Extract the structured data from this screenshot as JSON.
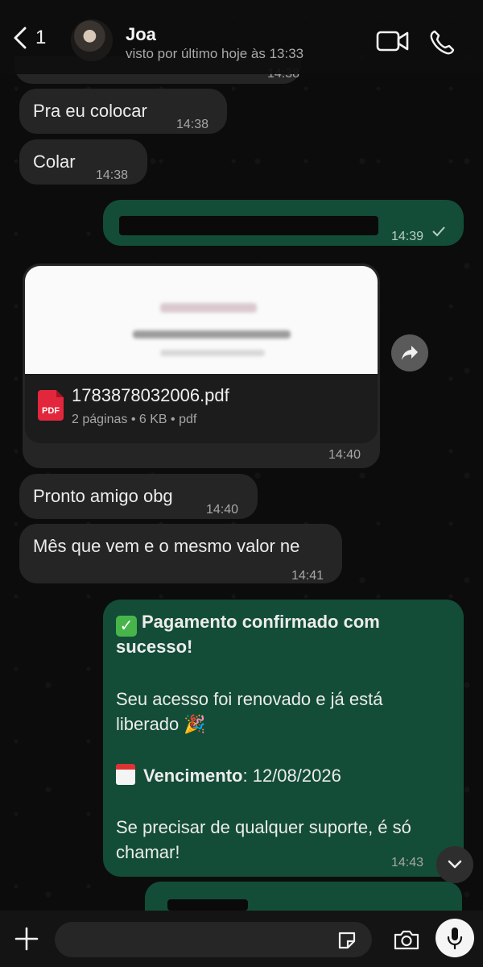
{
  "header": {
    "back_count": "1",
    "contact_name": "Joa",
    "status": "visto por último hoje às 13:33"
  },
  "messages": {
    "m0_time": "14:38",
    "m1_text": "Pra eu colocar",
    "m1_time": "14:38",
    "m2_text": "Colar",
    "m2_time": "14:38",
    "m3_time": "14:39",
    "doc_name": "1783878032006.pdf",
    "doc_meta": "2 páginas • 6 KB • pdf",
    "doc_badge": "PDF",
    "doc_time": "14:40",
    "m5_text": "Pronto amigo obg",
    "m5_time": "14:40",
    "m6_text": "Mês que vem e o mesmo valor ne",
    "m6_time": "14:41",
    "confirm_title_1": "Pagamento confirmado com",
    "confirm_title_2": "sucesso!",
    "confirm_body_1": "Seu acesso foi renovado e já está",
    "confirm_body_2": "liberado 🎉",
    "due_label": "Vencimento",
    "due_value": ": 12/08/2026",
    "support_1": "Se precisar de qualquer suporte, é só",
    "support_2": "chamar!",
    "confirm_time": "14:43"
  },
  "input": {
    "placeholder": ""
  },
  "colors": {
    "incoming_bubble": "#252525",
    "outgoing_bubble": "#134d37",
    "background": "#0c0c0c"
  },
  "icons": {
    "header": [
      "chevron-left-icon",
      "video-call-icon",
      "phone-icon"
    ],
    "bar": [
      "plus-icon",
      "sticker-icon",
      "camera-icon",
      "mic-icon"
    ]
  }
}
